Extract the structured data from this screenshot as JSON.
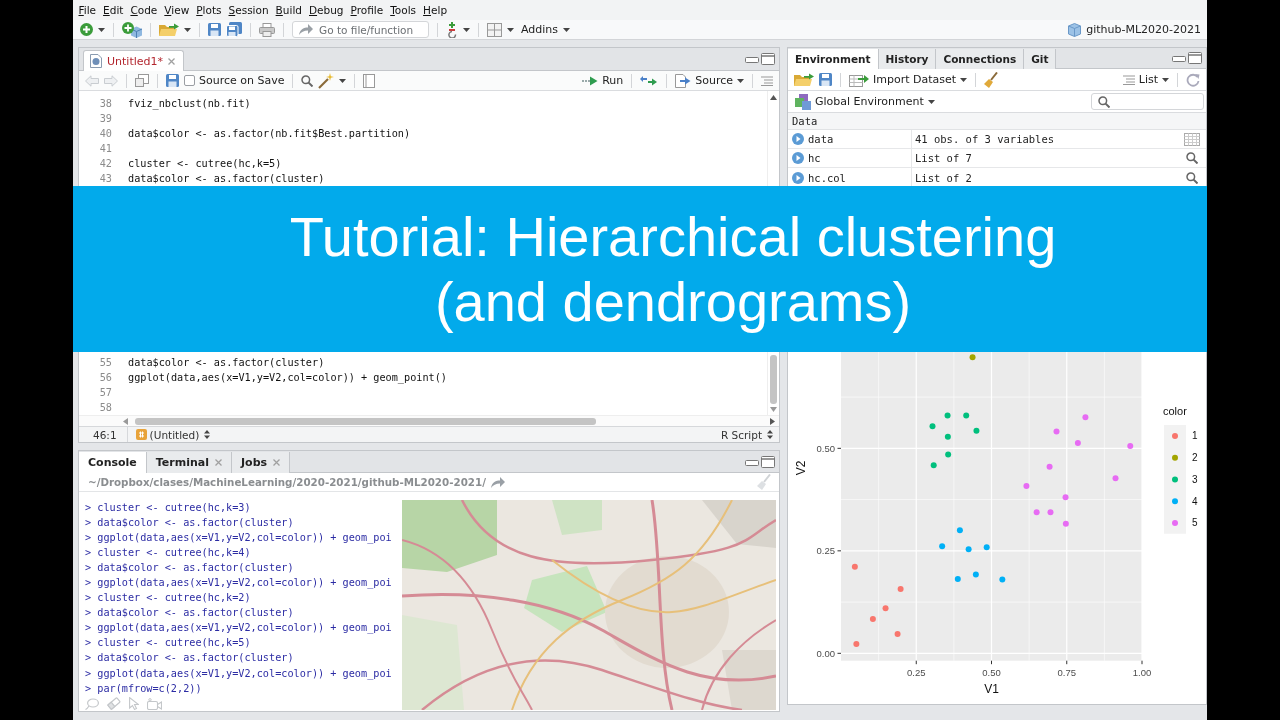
{
  "menu_bar": {
    "items": [
      "File",
      "Edit",
      "Code",
      "View",
      "Plots",
      "Session",
      "Build",
      "Debug",
      "Profile",
      "Tools",
      "Help"
    ]
  },
  "toolbar": {
    "go_to_file": {
      "placeholder": "Go to file/function"
    },
    "addins": "Addins",
    "project": "github-ML2020-2021"
  },
  "editor": {
    "tabs": [
      {
        "label": "Untitled1*",
        "selected": true,
        "unsaved": true
      }
    ],
    "toolbar": {
      "history_nav": {
        "disabled": true
      },
      "source_on_save": {
        "label": "Source on Save",
        "checked": false
      },
      "run": "Run",
      "source": "Source"
    },
    "code_sections": [
      {
        "lines": [
          {
            "number": "38",
            "text": "fviz_nbclust(nb.fit)"
          },
          {
            "number": "39"
          },
          {
            "number": "40",
            "text": "data$color <- as.factor(nb.fit$Best.partition)"
          },
          {
            "number": "41"
          },
          {
            "number": "42",
            "text": "cluster <- cutree(hc,k=5)"
          },
          {
            "number": "43",
            "text": "data$color <- as.factor(cluster)"
          }
        ]
      },
      {
        "lines": [
          {
            "number": "55",
            "text": "data$color <- as.factor(cluster)"
          },
          {
            "number": "56",
            "text": "ggplot(data,aes(x=V1,y=V2,col=color)) + geom_point()"
          },
          {
            "number": "57"
          },
          {
            "number": "58"
          }
        ]
      }
    ],
    "status_bar": {
      "position": "46:1",
      "scope": "(Untitled)",
      "file_type": "R Script"
    }
  },
  "console": {
    "tabs": [
      {
        "label": "Console",
        "selected": true,
        "closable": false
      },
      {
        "label": "Terminal",
        "selected": false,
        "closable": true
      },
      {
        "label": "Jobs",
        "selected": false,
        "closable": true
      }
    ],
    "path": "~/Dropbox/clases/MachineLearning/2020-2021/github-ML2020-2021/",
    "lines": [
      "> cluster <- cutree(hc,k=3)",
      "> data$color <- as.factor(cluster)",
      "> ggplot(data,aes(x=V1,y=V2,col=color)) + geom_poi",
      "> cluster <- cutree(hc,k=4)",
      "> data$color <- as.factor(cluster)",
      "> ggplot(data,aes(x=V1,y=V2,col=color)) + geom_poi",
      "> cluster <- cutree(hc,k=2)",
      "> data$color <- as.factor(cluster)",
      "> ggplot(data,aes(x=V1,y=V2,col=color)) + geom_poi",
      "> cluster <- cutree(hc,k=5)",
      "> data$color <- as.factor(cluster)",
      "> ggplot(data,aes(x=V1,y=V2,col=color)) + geom_poi",
      "> par(mfrow=c(2,2))"
    ]
  },
  "environment": {
    "tabs": [
      {
        "label": "Environment",
        "selected": true
      },
      {
        "label": "History",
        "selected": false
      },
      {
        "label": "Connections",
        "selected": false
      },
      {
        "label": "Git",
        "selected": false
      }
    ],
    "toolbar": {
      "import": "Import Dataset",
      "view": "List"
    },
    "scope": "Global Environment",
    "section": "Data",
    "rows": [
      {
        "name": "data",
        "value": "41 obs. of 3 variables",
        "kind": "table"
      },
      {
        "name": "hc",
        "value": "List of 7",
        "kind": "list"
      },
      {
        "name": "hc.col",
        "value": "List of 2",
        "kind": "list"
      }
    ]
  },
  "plot": {
    "legend_title": "color",
    "chart_data": {
      "type": "scatter",
      "xlabel": "V1",
      "ylabel": "V2",
      "xlim": [
        0,
        1
      ],
      "ylim": [
        -0.018,
        0.735
      ],
      "grid": true,
      "legend": "right",
      "xticks": [
        {
          "value": 0.25,
          "label": "0.25"
        },
        {
          "value": 0.5,
          "label": "0.50"
        },
        {
          "value": 0.75,
          "label": "0.75"
        },
        {
          "value": 1,
          "label": "1.00"
        }
      ],
      "yticks": [
        {
          "value": 0,
          "label": "0.00"
        },
        {
          "value": 0.25,
          "label": "0.25"
        },
        {
          "value": 0.5,
          "label": "0.50"
        }
      ],
      "series": [
        {
          "name": "1",
          "color": "#f8766d",
          "x": [
            0.046,
            0.198,
            0.148,
            0.106,
            0.188,
            0.051
          ],
          "values": [
            0.211,
            0.157,
            0.11,
            0.084,
            0.047,
            0.023
          ]
        },
        {
          "name": "2",
          "color": "#a3a500",
          "x": [
            0.437
          ],
          "values": [
            0.722
          ]
        },
        {
          "name": "3",
          "color": "#00bf7d",
          "x": [
            0.354,
            0.416,
            0.304,
            0.45,
            0.355,
            0.356,
            0.308
          ],
          "values": [
            0.58,
            0.58,
            0.554,
            0.543,
            0.528,
            0.485,
            0.459
          ]
        },
        {
          "name": "4",
          "color": "#00b0f6",
          "x": [
            0.395,
            0.336,
            0.484,
            0.424,
            0.448,
            0.388,
            0.536
          ],
          "values": [
            0.3,
            0.261,
            0.259,
            0.254,
            0.192,
            0.181,
            0.18
          ]
        },
        {
          "name": "5",
          "color": "#e76bf3",
          "x": [
            0.812,
            0.716,
            0.787,
            0.961,
            0.693,
            0.912,
            0.616,
            0.746,
            0.65,
            0.696,
            0.747
          ],
          "values": [
            0.576,
            0.541,
            0.513,
            0.506,
            0.455,
            0.427,
            0.408,
            0.381,
            0.344,
            0.344,
            0.316
          ]
        }
      ]
    }
  },
  "banner": {
    "title": "Tutorial: Hierarchical clustering (and dendrograms)"
  }
}
